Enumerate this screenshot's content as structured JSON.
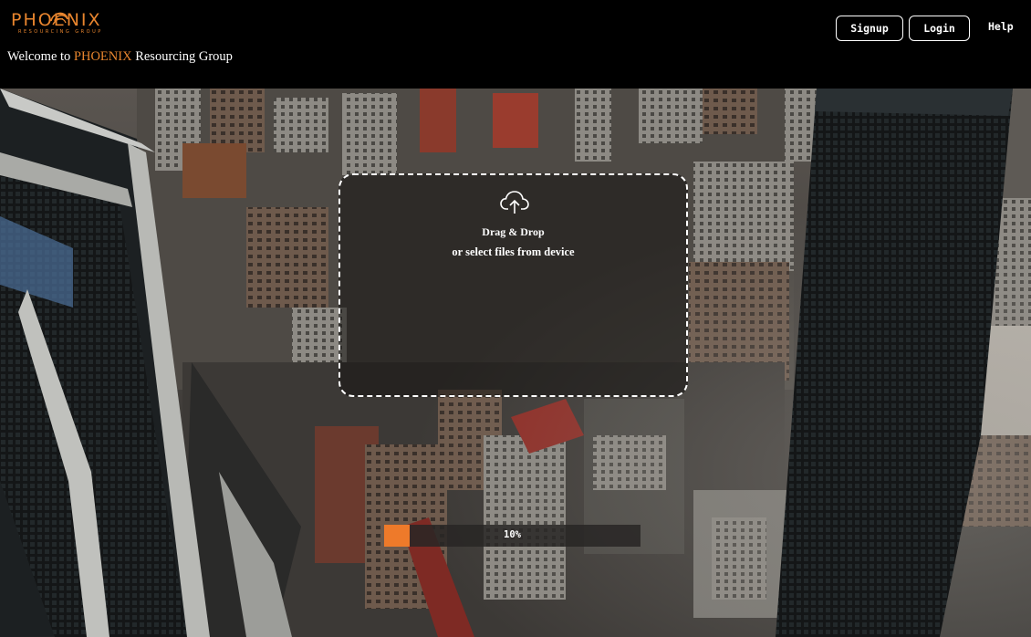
{
  "brand": {
    "logo_text": "PHOENIX",
    "logo_subtext": "RESOURCING GROUP",
    "accent_color": "#e8852e"
  },
  "header": {
    "welcome_prefix": "Welcome to ",
    "welcome_brand": "PHOENIX",
    "welcome_suffix": " Resourcing Group",
    "signup_label": "Signup",
    "login_label": "Login",
    "help_label": "Help"
  },
  "upload": {
    "icon": "cloud-upload-icon",
    "line1": "Drag & Drop",
    "line2": "or select files from device"
  },
  "progress": {
    "value": 0.1,
    "label": "10%",
    "fill_color": "#ee7a2a"
  }
}
